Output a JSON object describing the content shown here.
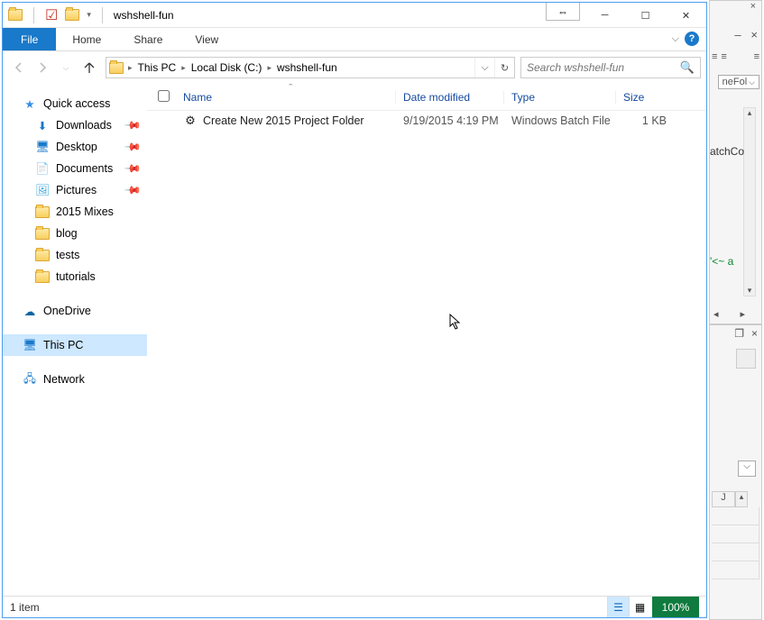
{
  "window": {
    "title": "wshshell-fun",
    "tablet_glyph": "⇔"
  },
  "ribbon": {
    "file": "File",
    "home": "Home",
    "share": "Share",
    "view": "View"
  },
  "breadcrumb": {
    "p0": "This PC",
    "p1": "Local Disk (C:)",
    "p2": "wshshell-fun"
  },
  "search": {
    "placeholder": "Search wshshell-fun"
  },
  "nav": {
    "quick_access": "Quick access",
    "downloads": "Downloads",
    "desktop": "Desktop",
    "documents": "Documents",
    "pictures": "Pictures",
    "mixes": "2015 Mixes",
    "blog": "blog",
    "tests": "tests",
    "tutorials": "tutorials",
    "onedrive": "OneDrive",
    "this_pc": "This PC",
    "network": "Network"
  },
  "columns": {
    "name": "Name",
    "date": "Date modified",
    "type": "Type",
    "size": "Size"
  },
  "files": {
    "row0": {
      "name": "Create New 2015 Project Folder",
      "date": "9/19/2015 4:19 PM",
      "type": "Windows Batch File",
      "size": "1 KB"
    }
  },
  "status": {
    "count": "1 item",
    "zoom": "100%"
  },
  "bg": {
    "combo": "neFol",
    "text1": "atchCo",
    "text2": "'<~ a",
    "cell_j": "J"
  }
}
